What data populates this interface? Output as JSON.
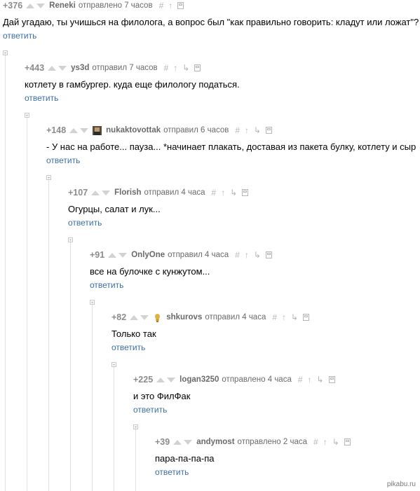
{
  "comments": [
    {
      "rating": "+376",
      "user": "Reneki",
      "meta": "отправлено 7 часов",
      "text": "Дай угадаю, ты учишься на филолога, а вопрос был \"как правильно говорить: кладут или ложат\"?",
      "reply": "ответить"
    },
    {
      "rating": "+443",
      "user": "ys3d",
      "meta": "отправил 7 часов",
      "text": "котлету в гамбургер. куда еще филологу податься.",
      "reply": "ответить"
    },
    {
      "rating": "+148",
      "user": "nukaktovottak",
      "meta": "отправил 6 часов",
      "text": "- У нас на работе... пауза... *начинает плакать, доставая из пакета булку, котлету и сыр",
      "reply": "ответить"
    },
    {
      "rating": "+107",
      "user": "Florish",
      "meta": "отправил 4 часа",
      "text": "Огурцы, салат и лук...",
      "reply": "ответить"
    },
    {
      "rating": "+91",
      "user": "OnlyOne",
      "meta": "отправил 4 часа",
      "text": "все на булочке с кунжутом...",
      "reply": "ответить"
    },
    {
      "rating": "+82",
      "user": "shkurovs",
      "meta": "отправил 4 часа",
      "text": "Только так",
      "reply": "ответить"
    },
    {
      "rating": "+225",
      "user": "logan3250",
      "meta": "отправлено 4 часа",
      "text": "и это ФилФак",
      "reply": "ответить"
    },
    {
      "rating": "+39",
      "user": "andymost",
      "meta": "отправлено 2 часа",
      "text": "пара-па-па-па",
      "reply": "ответить"
    }
  ],
  "icons": {
    "hash": "#",
    "arrow": "↑",
    "branch": "↳",
    "save": "save-icon"
  },
  "logo": "pikabu.ru",
  "colors": {
    "rating": "#8c8c8c",
    "user": "#6a6a6a",
    "reply": "#3d6fa3",
    "icon": "#b5b5b5"
  }
}
